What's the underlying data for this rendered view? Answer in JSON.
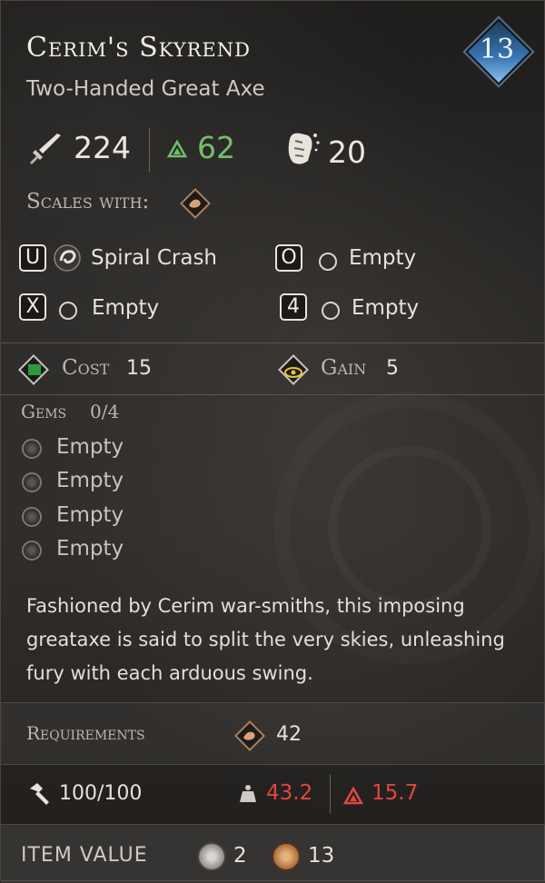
{
  "item": {
    "name": "Cerim's Skyrend",
    "type": "Two-Handed Great Axe",
    "level": "13"
  },
  "stats": {
    "damage": "224",
    "upgrade_bonus": "62",
    "stagger": "20"
  },
  "scaling": {
    "label": "Scales with:",
    "attribute_icon": "strength-arm-icon"
  },
  "skill_slots": [
    {
      "key": "U",
      "name": "Spiral Crash",
      "icon": "spiral-crash-icon"
    },
    {
      "key": "O",
      "name": "Empty",
      "icon": "empty-slot-icon"
    },
    {
      "key": "X",
      "name": "Empty",
      "icon": "empty-slot-icon"
    },
    {
      "key": "4",
      "name": "Empty",
      "icon": "empty-slot-icon"
    }
  ],
  "focus": {
    "cost_label": "Cost",
    "cost_value": "15",
    "gain_label": "Gain",
    "gain_value": "5"
  },
  "gems": {
    "label": "Gems",
    "count": "0/4",
    "slots": [
      "Empty",
      "Empty",
      "Empty",
      "Empty"
    ]
  },
  "description": "Fashioned by Cerim war-smiths, this imposing greataxe is said to split the very skies, unleashing fury with each arduous swing.",
  "requirements": {
    "label": "Requirements",
    "strength": "42"
  },
  "durability": {
    "value": "100/100",
    "weight": "43.2",
    "upgrade": "15.7"
  },
  "value": {
    "label": "ITEM VALUE",
    "silver": "2",
    "gold": "13"
  },
  "colors": {
    "level_badge": "#3b77b5",
    "positive": "#6fbf6a",
    "negative": "#e0473f",
    "focus_cost": "#2e9a3c",
    "focus_gain": "#e6c830"
  }
}
